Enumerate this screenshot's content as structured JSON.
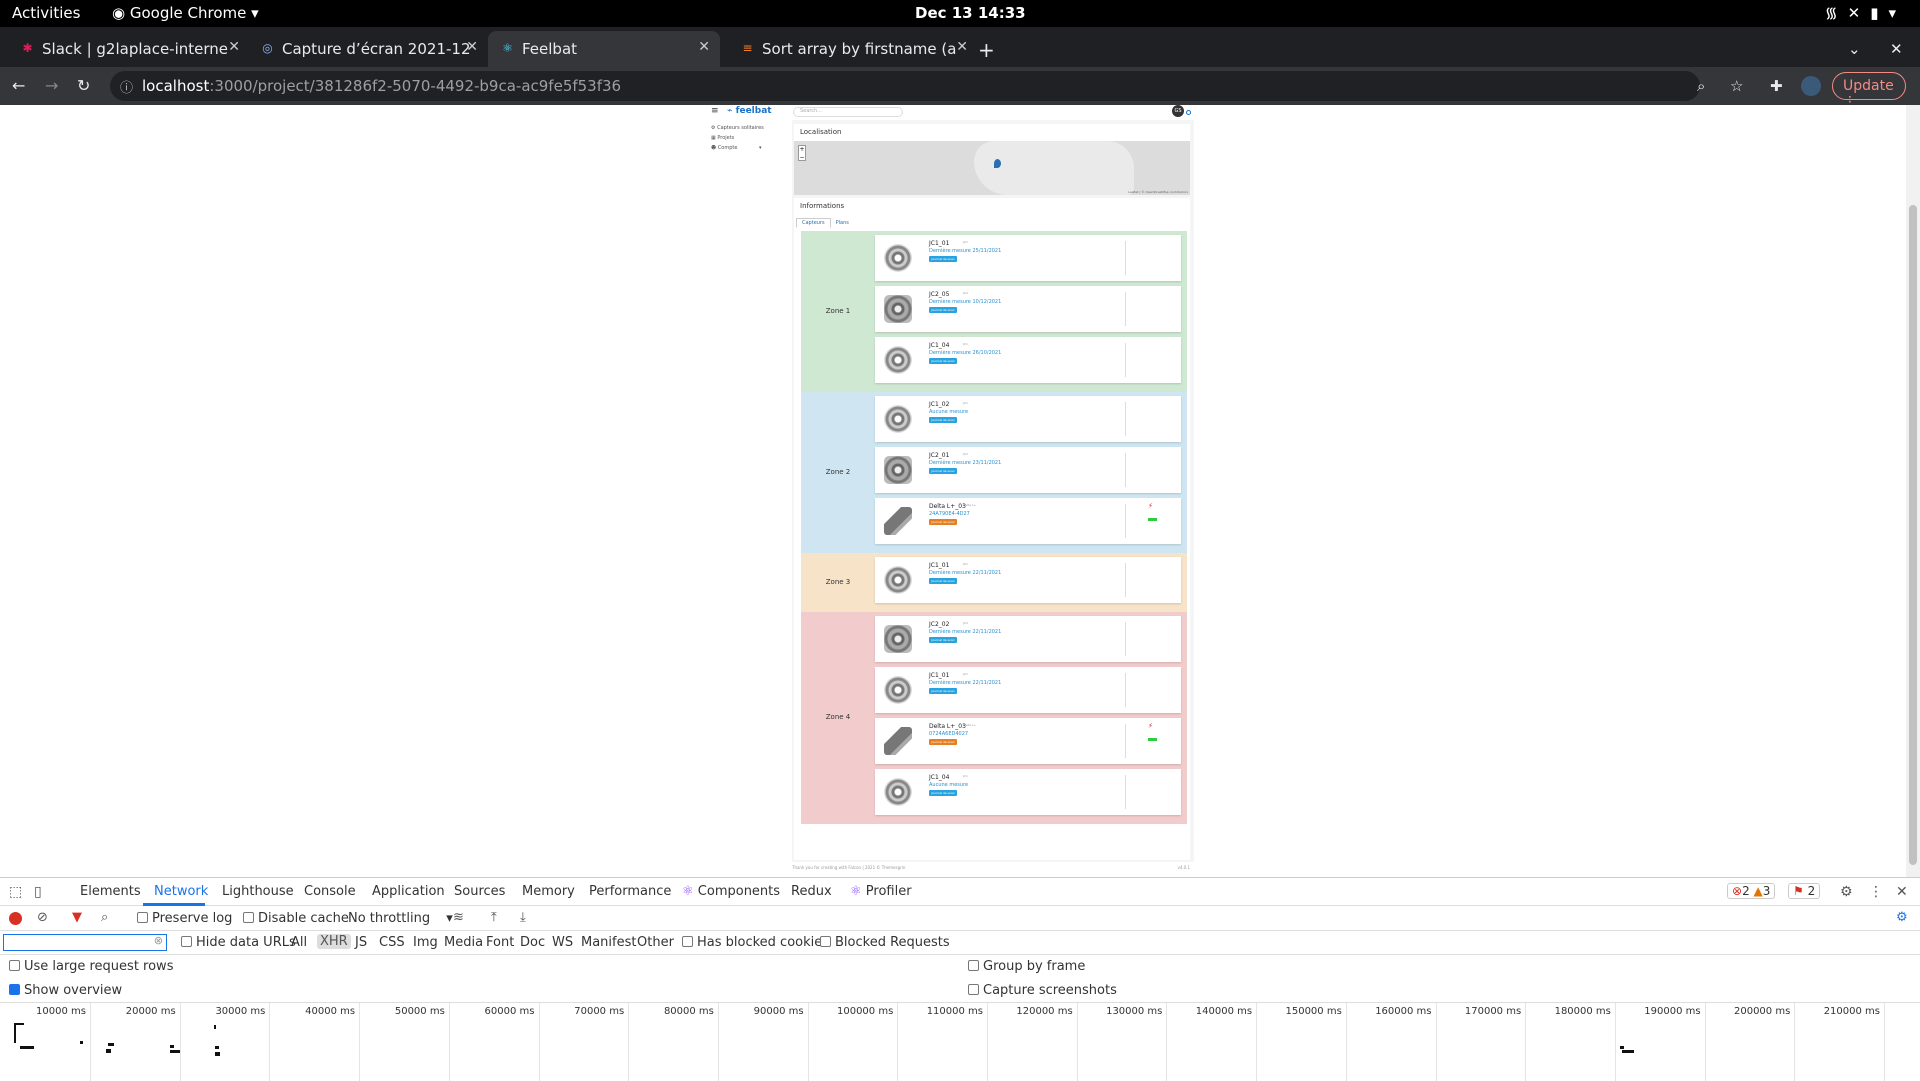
{
  "system_bar": {
    "activities": "Activities",
    "app": "Google Chrome",
    "clock": "Dec 13  14:33"
  },
  "tabs": [
    {
      "label": "Slack | g2laplace-interne",
      "icon": "slack-icon"
    },
    {
      "label": "Capture d’écran 2021-12",
      "icon": "image-icon"
    },
    {
      "label": "Feelbat",
      "icon": "react-icon"
    },
    {
      "label": "Sort array by firstname (a",
      "icon": "stackoverflow-icon"
    }
  ],
  "omnibox": {
    "host": "localhost",
    "path": ":3000/project/381286f2-5070-4492-b9ca-ac9fe5f53f36",
    "update_label": "Update"
  },
  "app": {
    "brand": "feelbat",
    "search_placeholder": "Search...",
    "user_initials": "GS",
    "sidenav": [
      "Capteurs solitaires",
      "Projets",
      "Compte"
    ],
    "localisation_title": "Localisation",
    "map_attribution": "Leaflet | © OpenStreetMap contributors",
    "informations_title": "Informations",
    "info_tabs": [
      "Capteurs",
      "Plans"
    ],
    "zones": [
      {
        "name": "Zone 1",
        "color": "#cfe8d2",
        "sensors": [
          {
            "name": "JC1_01",
            "sub": "JC1",
            "mesure": "Dernière mesure 25/11/2021",
            "badge": "Journal de suivi",
            "badge_color": "#29a3e0",
            "pic": "round"
          },
          {
            "name": "JC2_05",
            "sub": "JC2",
            "mesure": "Dernière mesure 10/12/2021",
            "badge": "Journal de suivi",
            "badge_color": "#29a3e0",
            "pic": "square"
          },
          {
            "name": "JC1_04",
            "sub": "JC1",
            "mesure": "Dernière mesure 26/10/2021",
            "badge": "Journal de suivi",
            "badge_color": "#29a3e0",
            "pic": "round"
          }
        ]
      },
      {
        "name": "Zone 2",
        "color": "#cfe6f2",
        "sensors": [
          {
            "name": "JC1_02",
            "sub": "JC1",
            "mesure": "Aucune mesure",
            "badge": "Journal de suivi",
            "badge_color": "#29a3e0",
            "pic": "round"
          },
          {
            "name": "JC2_01",
            "sub": "JC2",
            "mesure": "Dernière mesure 23/11/2021",
            "badge": "Journal de suivi",
            "badge_color": "#29a3e0",
            "pic": "square"
          },
          {
            "name": "Delta L+_03",
            "sub": "Delta L+",
            "mesure": "24A790E4-4D27",
            "badge": "Journal de suivi",
            "badge_color": "#e67e22",
            "pic": "probe",
            "battery": "battery-low-icon"
          }
        ]
      },
      {
        "name": "Zone 3",
        "color": "#f7e3c8",
        "sensors": [
          {
            "name": "JC1_01",
            "sub": "JC1",
            "mesure": "Dernière mesure 22/11/2021",
            "badge": "Journal de suivi",
            "badge_color": "#29a3e0",
            "pic": "round"
          }
        ]
      },
      {
        "name": "Zone 4",
        "color": "#f2cccc",
        "sensors": [
          {
            "name": "JC2_02",
            "sub": "JC2",
            "mesure": "Dernière mesure 22/11/2021",
            "badge": "Journal de suivi",
            "badge_color": "#29a3e0",
            "pic": "square"
          },
          {
            "name": "JC1_01",
            "sub": "JC1",
            "mesure": "Dernière mesure 22/11/2021",
            "badge": "Journal de suivi",
            "badge_color": "#29a3e0",
            "pic": "round"
          },
          {
            "name": "Delta L+_03",
            "sub": "Delta L+",
            "mesure": "0724A6ED4027",
            "badge": "Journal de suivi",
            "badge_color": "#e67e22",
            "pic": "probe",
            "battery": "battery-low-icon"
          },
          {
            "name": "JC1_04",
            "sub": "JC1",
            "mesure": "Aucune mesure",
            "badge": "Journal de suivi",
            "badge_color": "#29a3e0",
            "pic": "round"
          }
        ]
      }
    ],
    "footer_text": "Thank you for creating with Falcon | 2021 © Themesgrin",
    "footer_version": "v4.0.1"
  },
  "devtools": {
    "panels": [
      "Elements",
      "Network",
      "Lighthouse",
      "Console",
      "Application",
      "Sources",
      "Memory",
      "Performance",
      "Components",
      "Redux",
      "Profiler"
    ],
    "active_panel": "Network",
    "errors": "2",
    "warnings": "3",
    "issues": "2",
    "preserve_log": "Preserve log",
    "disable_cache": "Disable cache",
    "throttling": "No throttling",
    "hide_data_urls": "Hide data URLs",
    "type_filters": [
      "All",
      "XHR",
      "JS",
      "CSS",
      "Img",
      "Media",
      "Font",
      "Doc",
      "WS",
      "Manifest",
      "Other"
    ],
    "selected_type": "XHR",
    "has_blocked_cookies": "Has blocked cookies",
    "blocked_requests": "Blocked Requests",
    "large_rows": "Use large request rows",
    "group_by_frame": "Group by frame",
    "show_overview": "Show overview",
    "capture_screenshots": "Capture screenshots",
    "timeline_ticks": [
      "10000 ms",
      "20000 ms",
      "30000 ms",
      "40000 ms",
      "50000 ms",
      "60000 ms",
      "70000 ms",
      "80000 ms",
      "90000 ms",
      "100000 ms",
      "110000 ms",
      "120000 ms",
      "130000 ms",
      "140000 ms",
      "150000 ms",
      "160000 ms",
      "170000 ms",
      "180000 ms",
      "190000 ms",
      "200000 ms",
      "210000 ms"
    ]
  }
}
